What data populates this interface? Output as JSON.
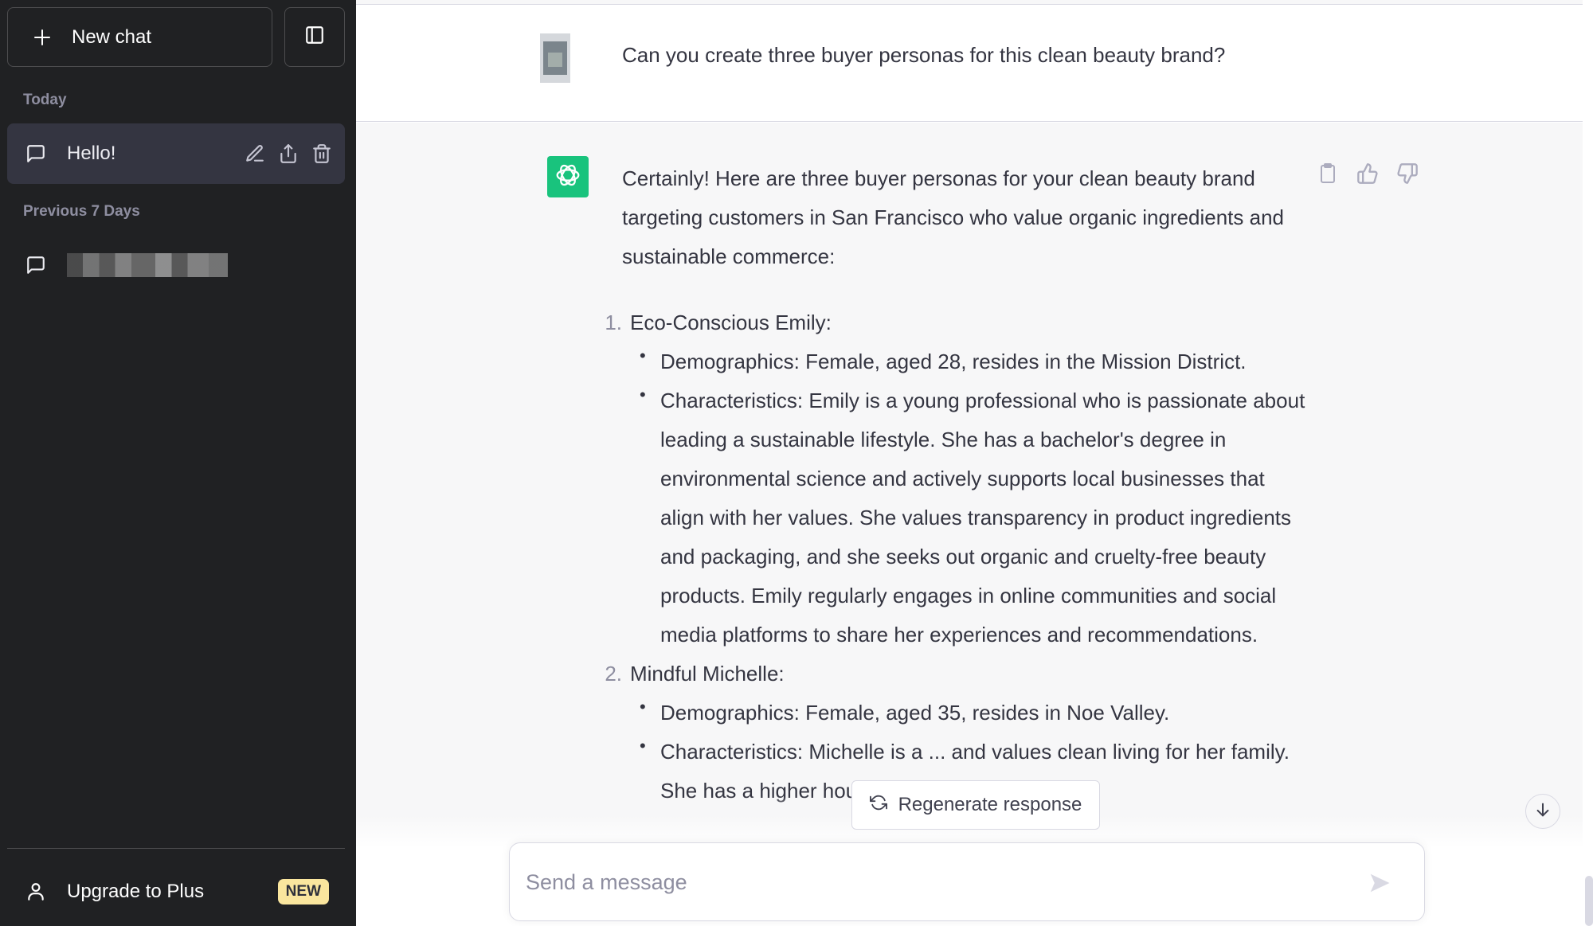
{
  "sidebar": {
    "new_chat_label": "New chat",
    "sections": [
      {
        "label": "Today",
        "items": [
          {
            "title": "Hello!",
            "active": true
          }
        ]
      },
      {
        "label": "Previous 7 Days",
        "items": [
          {
            "title": "",
            "blurred": true
          }
        ]
      }
    ],
    "upgrade_label": "Upgrade to Plus",
    "upgrade_badge": "NEW"
  },
  "conversation": {
    "user_message": "Can you create three buyer personas for this clean beauty brand?",
    "assistant": {
      "intro": "Certainly! Here are three buyer personas for your clean beauty brand targeting customers in San Francisco who value organic ingredients and sustainable commerce:",
      "personas": [
        {
          "number": "1.",
          "name": "Eco-Conscious Emily:",
          "points": [
            "Demographics: Female, aged 28, resides in the Mission District.",
            "Characteristics: Emily is a young professional who is passionate about leading a sustainable lifestyle. She has a bachelor's degree in environmental science and actively supports local businesses that align with her values. She values transparency in product ingredients and packaging, and she seeks out organic and cruelty-free beauty products. Emily regularly engages in online communities and social media platforms to share her experiences and recommendations."
          ]
        },
        {
          "number": "2.",
          "name": "Mindful Michelle:",
          "points": [
            "Demographics: Female, aged 35, resides in Noe Valley.",
            "Characteristics: Michelle is a ... and values clean living for her family. She has a higher household income and"
          ]
        }
      ]
    }
  },
  "composer": {
    "regenerate_label": "Regenerate response",
    "placeholder": "Send a message",
    "value": ""
  },
  "colors": {
    "sidebar_bg": "#202123",
    "active_item_bg": "#343541",
    "assistant_avatar": "#19c37d",
    "badge_bg": "#fae69e",
    "assistant_bg": "#f7f7f8"
  }
}
